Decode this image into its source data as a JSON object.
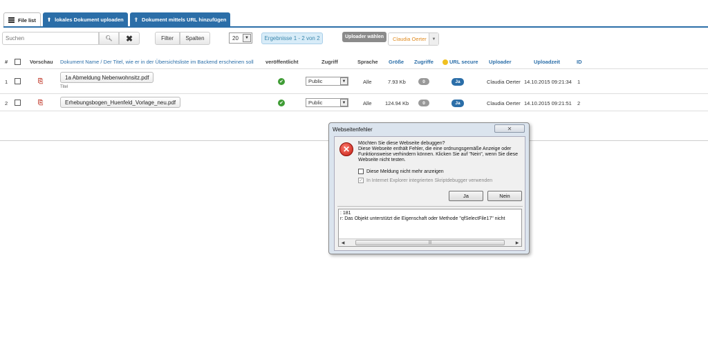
{
  "tabs": [
    {
      "label": "File list"
    },
    {
      "label": "lokales Dokument uploaden"
    },
    {
      "label": "Dokument mittels URL hinzufügen"
    }
  ],
  "toolbar": {
    "search_placeholder": "Suchen",
    "filter_label": "Filter",
    "columns_label": "Spalten",
    "page_size": "20",
    "results_text": "Ergebnisse 1 - 2 von 2",
    "uploader_label": "Uploader wählen",
    "uploader_value": "Claudia Oerter"
  },
  "table": {
    "headers": {
      "num": "#",
      "preview": "Vorschau",
      "name": "Dokument Name / Der Titel, wie er in der Übersichtsliste im Backend erscheinen soll",
      "published": "veröffentlicht",
      "access": "Zugriff",
      "language": "Sprache",
      "size": "Größe",
      "hits": "Zugriffe",
      "url_secure": "URL secure",
      "uploader": "Uploader",
      "upload_time": "Uploadzeit",
      "id": "ID"
    },
    "rows": [
      {
        "num": "1",
        "name": "1a Abmeldung Nebenwohnsitz.pdf",
        "subtitle": "Titel",
        "access": "Public",
        "language": "Alle",
        "size": "7.93 Kb",
        "hits": "0",
        "url_secure": "Ja",
        "uploader": "Claudia Oerter",
        "upload_time": "14.10.2015 09:21:34",
        "id": "1"
      },
      {
        "num": "2",
        "name": "Erhebungsbogen_Huenfeld_Vorlage_neu.pdf",
        "subtitle": "",
        "access": "Public",
        "language": "Alle",
        "size": "124.94 Kb",
        "hits": "0",
        "url_secure": "Ja",
        "uploader": "Claudia Oerter",
        "upload_time": "14.10.2015 09:21:51",
        "id": "2"
      }
    ]
  },
  "dialog": {
    "title": "Webseitenfehler",
    "question": "Möchten Sie diese Webseite debuggen?",
    "message": "Diese Webseite enthält Fehler, die eine ordnungsgemäße Anzeige oder Funktionsweise verhindern können. Klicken Sie auf \"Nein\", wenn Sie diese Webseite nicht testen.",
    "checkbox_1": "Diese Meldung nicht mehr anzeigen",
    "checkbox_2": "In Internet Explorer integrierten Skriptdebugger verwenden",
    "yes_label": "Ja",
    "no_label": "Nein",
    "log_line_1": ": 181",
    "log_line_2": "r: Das Objekt unterstützt die Eigenschaft oder Methode \"qfSelectFile17\" nicht"
  }
}
